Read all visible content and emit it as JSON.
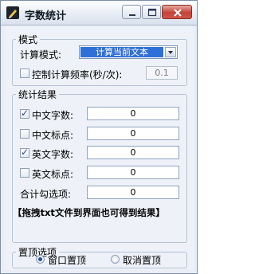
{
  "window": {
    "title": "字数统计"
  },
  "mode_group": {
    "legend": "模式",
    "calc_mode_label": "计算模式:",
    "calc_mode_value": "计算当前文本",
    "control_freq_label": "控制计算频率(秒/次):",
    "control_freq_checked": false,
    "freq_value": "0.1"
  },
  "stats_group": {
    "legend": "统计结果",
    "rows": [
      {
        "label": "中文字数:",
        "checked": true,
        "value": "0"
      },
      {
        "label": "中文标点:",
        "checked": false,
        "value": "0"
      },
      {
        "label": "英文字数:",
        "checked": true,
        "value": "0"
      },
      {
        "label": "英文标点:",
        "checked": false,
        "value": "0"
      }
    ],
    "total_label": "合计勾选项:",
    "total_value": "0",
    "hint": "【拖拽txt文件到界面也可得到结果】"
  },
  "top_group": {
    "legend": "置顶选项",
    "options": [
      {
        "label": "窗口置顶",
        "selected": true
      },
      {
        "label": "取消置顶",
        "selected": false
      }
    ]
  }
}
